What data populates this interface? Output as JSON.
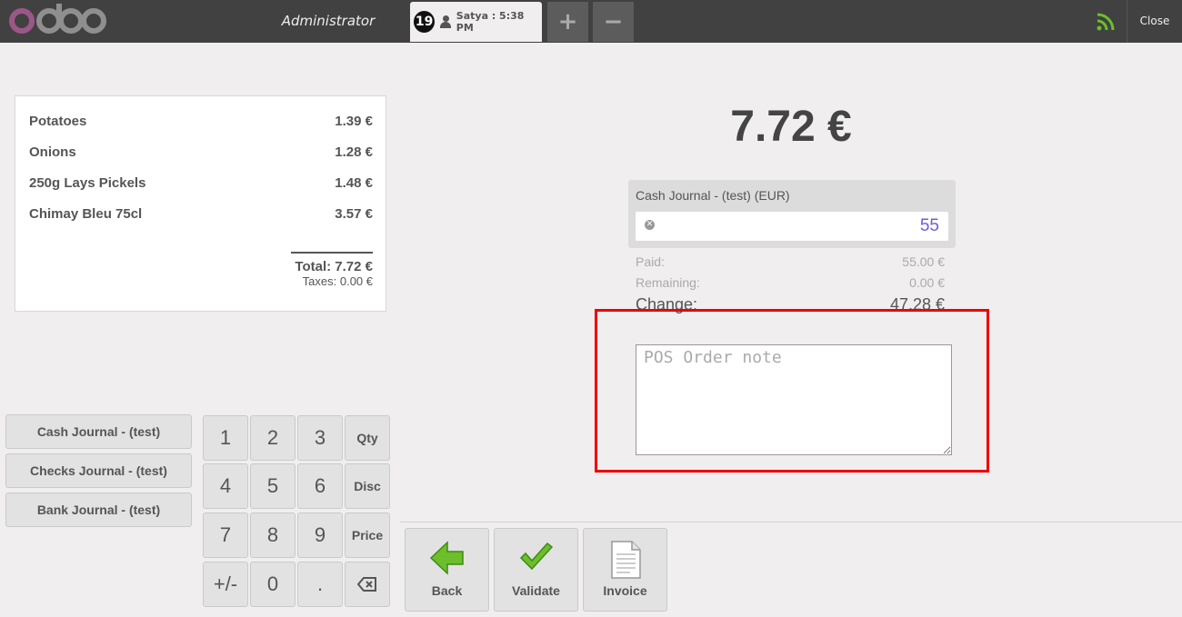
{
  "header": {
    "user": "Administrator",
    "order_number": "19",
    "order_label": "Satya : 5:38 PM",
    "add_label": "+",
    "remove_label": "−",
    "close_label": "Close"
  },
  "order": {
    "lines": [
      {
        "name": "Potatoes",
        "price": "1.39 €"
      },
      {
        "name": "Onions",
        "price": "1.28 €"
      },
      {
        "name": "250g Lays Pickels",
        "price": "1.48 €"
      },
      {
        "name": "Chimay Bleu 75cl",
        "price": "3.57 €"
      }
    ],
    "total": "Total: 7.72 €",
    "taxes": "Taxes: 0.00 €"
  },
  "payment_methods": [
    "Cash Journal - (test)",
    "Checks Journal - (test)",
    "Bank Journal - (test)"
  ],
  "numpad": {
    "keys": [
      "1",
      "2",
      "3",
      "Qty",
      "4",
      "5",
      "6",
      "Disc",
      "7",
      "8",
      "9",
      "Price",
      "+/-",
      "0",
      ".",
      "⌫"
    ]
  },
  "payment": {
    "due": "7.72 €",
    "line_name": "Cash Journal - (test) (EUR)",
    "line_amount": "55",
    "paid_label": "Paid:",
    "paid_value": "55.00 €",
    "remaining_label": "Remaining:",
    "remaining_value": "0.00 €",
    "change_label": "Change:",
    "change_value": "47.28 €",
    "note_placeholder": "POS Order note"
  },
  "actions": {
    "back": "Back",
    "validate": "Validate",
    "invoice": "Invoice"
  },
  "colors": {
    "topbar": "#414141",
    "amount_text": "#6b5fd8",
    "highlight": "#ee0000",
    "validate_icon": "#6cbf2a"
  }
}
